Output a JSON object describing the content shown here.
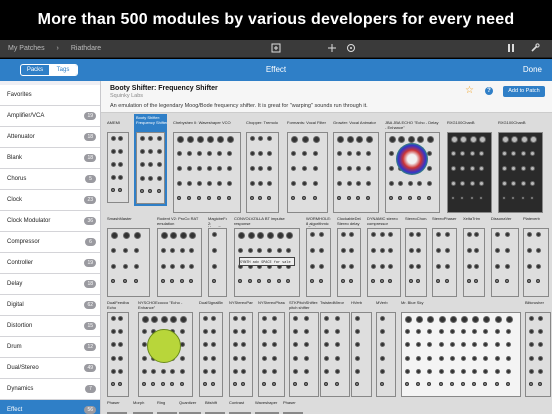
{
  "banner": {
    "text": "More than 500 modules by various developers for every need"
  },
  "topbar": {
    "crumb1": "My Patches",
    "sep": "›",
    "crumb2": "Riathdare"
  },
  "appbar": {
    "tab_packs": "Packs",
    "tab_tags": "Tags",
    "title": "Effect",
    "done": "Done"
  },
  "sidebar": {
    "items": [
      {
        "label": "Favorites",
        "count": ""
      },
      {
        "label": "Amplifier/VCA",
        "count": "19"
      },
      {
        "label": "Attenuator",
        "count": "18"
      },
      {
        "label": "Blank",
        "count": "18"
      },
      {
        "label": "Chorus",
        "count": "5"
      },
      {
        "label": "Clock",
        "count": "23"
      },
      {
        "label": "Clock Modulator",
        "count": "36"
      },
      {
        "label": "Compressor",
        "count": "6"
      },
      {
        "label": "Controller",
        "count": "19"
      },
      {
        "label": "Delay",
        "count": "18"
      },
      {
        "label": "Digital",
        "count": "62"
      },
      {
        "label": "Distortion",
        "count": "15"
      },
      {
        "label": "Drum",
        "count": "12"
      },
      {
        "label": "Dual/Stereo",
        "count": "49"
      },
      {
        "label": "Dynamics",
        "count": "7"
      },
      {
        "label": "Effect",
        "count": "56"
      }
    ]
  },
  "info": {
    "name": "Booty Shifter: Frequency Shifter",
    "brand": "Squinky Labs",
    "desc": "An emulation of the legendary Moog/Bode frequency shifter. It is great for \"warping\" sounds run through it.",
    "add": "Add to Patch"
  },
  "modules": {
    "m0": "AMEMI",
    "m1": "Booty Shifter: Frequency Shifter",
    "m2": "Chebyshev II: Waveshaper VCO",
    "m3": "Chopper: Tremolo",
    "m4": "Formants: Vocal Filter",
    "m5": "Growler: Vocal Animator",
    "m6": "JBA JBA ECHO \"Echo - Delay - Enhance\"",
    "m7": "RXG100ChanB",
    "m8": "RXG100ChanB",
    "m9": "SmashMaster",
    "m10": "Rodent V2: ProCo RAT emulation",
    "m11": "MagicbeFox 2: Magnificent module",
    "m12": "CONVOLVZILLA BT impulse response",
    "m13": "WORMHOLE: 8 algorithmic effect",
    "m14": "ClockableDelay: Stereo delay",
    "m15": "DYNAMIC stereo compressor",
    "m16": "StereoChorus",
    "m17": "StereoPhaser",
    "m18": "XeltaTrim",
    "m19": "DissonaVer",
    "m20": "Plateverb",
    "m21": "DualFeedback Echo",
    "m22": "NYSCHOEcocco \"Echo - Enhance\"",
    "m23": "DualSignalBreaker",
    "m24": "NYStereoPan",
    "m25": "NYStereoPhaser",
    "m26": "STKPitchShifter: pitch shifter",
    "m27": "TwistedMirror",
    "m28": "HVerb",
    "m29": "MVerb",
    "m30": "Mr. Blue Sky",
    "m31": "Blitcrusher",
    "m32": "Phaser",
    "m33": "Morph",
    "m34": "Ring",
    "m35": "Quantizer",
    "m36": "Bitshift",
    "m37": "Contrast",
    "m38": "Waveshaper",
    "m39": "Phaser"
  },
  "screens": {
    "synth_text": "SYNTH adv SPACE for sale"
  },
  "colors": {
    "accent": "#2f7fc7",
    "panel_light": "#dedede",
    "panel_dark": "#2a2a2a"
  }
}
